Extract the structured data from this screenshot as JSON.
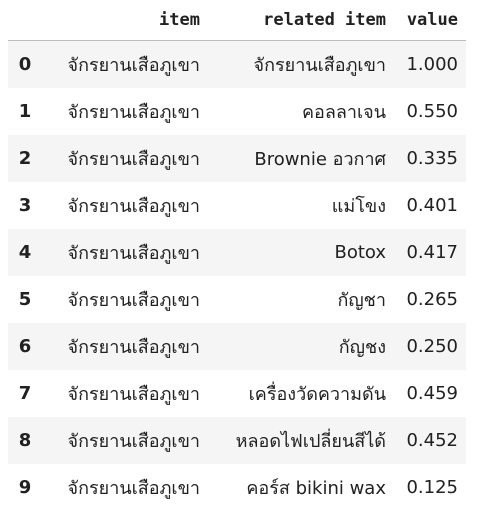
{
  "table": {
    "columns": [
      "",
      "item",
      "related item",
      "value"
    ],
    "rows": [
      {
        "index": "0",
        "item": "จักรยานเสือภูเขา",
        "related": "จักรยานเสือภูเขา",
        "value": "1.000"
      },
      {
        "index": "1",
        "item": "จักรยานเสือภูเขา",
        "related": "คอลลาเจน",
        "value": "0.550"
      },
      {
        "index": "2",
        "item": "จักรยานเสือภูเขา",
        "related": "Brownie อวกาศ",
        "value": "0.335"
      },
      {
        "index": "3",
        "item": "จักรยานเสือภูเขา",
        "related": "แม่โขง",
        "value": "0.401"
      },
      {
        "index": "4",
        "item": "จักรยานเสือภูเขา",
        "related": "Botox",
        "value": "0.417"
      },
      {
        "index": "5",
        "item": "จักรยานเสือภูเขา",
        "related": "กัญชา",
        "value": "0.265"
      },
      {
        "index": "6",
        "item": "จักรยานเสือภูเขา",
        "related": "กัญชง",
        "value": "0.250"
      },
      {
        "index": "7",
        "item": "จักรยานเสือภูเขา",
        "related": "เครื่องวัดความดัน",
        "value": "0.459"
      },
      {
        "index": "8",
        "item": "จักรยานเสือภูเขา",
        "related": "หลอดไฟเปลี่ยนสีได้",
        "value": "0.452"
      },
      {
        "index": "9",
        "item": "จักรยานเสือภูเขา",
        "related": "คอร์ส bikini wax",
        "value": "0.125"
      }
    ]
  }
}
